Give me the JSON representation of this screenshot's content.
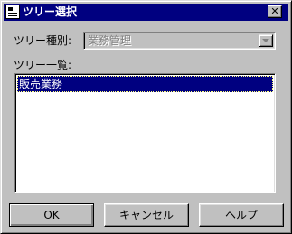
{
  "window": {
    "title": "ツリー選択",
    "close_glyph": "✕"
  },
  "tree_type": {
    "label": "ツリー種別:",
    "value": "業務管理"
  },
  "tree_list": {
    "label": "ツリー一覧:",
    "items": [
      {
        "label": "販売業務",
        "selected": true
      }
    ]
  },
  "buttons": {
    "ok": "OK",
    "cancel": "キャンセル",
    "help": "ヘルプ"
  },
  "colors": {
    "title_bar": "#000080",
    "selection": "#000080",
    "face": "#c0c0c0"
  }
}
